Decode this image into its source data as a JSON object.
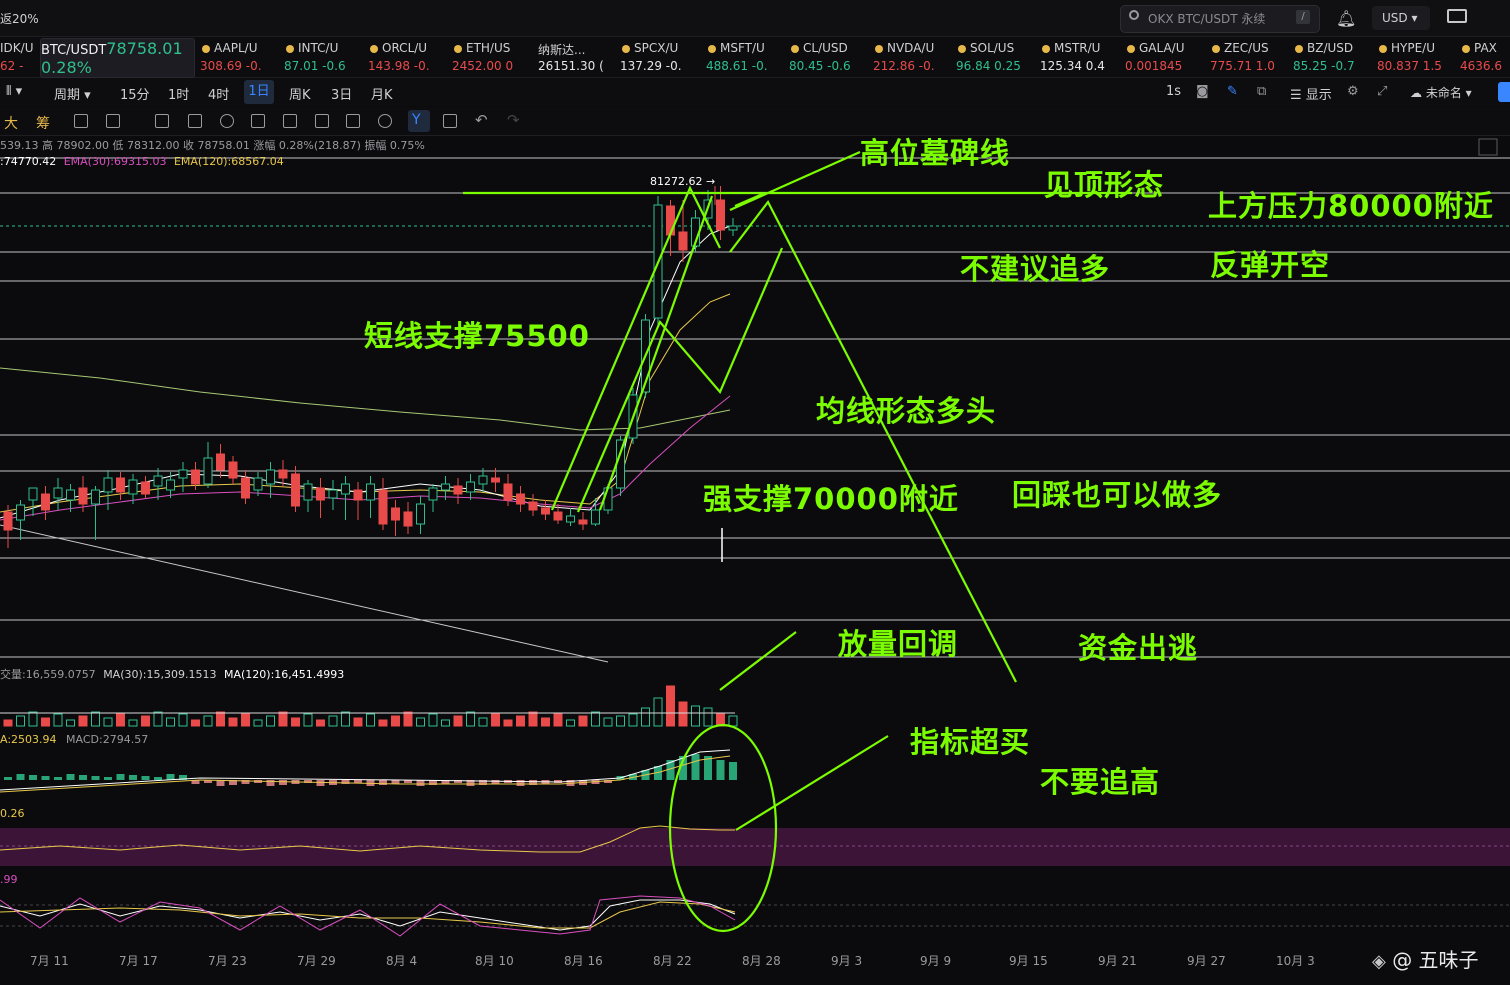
{
  "topbar": {
    "left_text": "返20%",
    "search_placeholder": "OKX BTC/USDT 永续",
    "search_key": "/",
    "currency": "USD ▾",
    "bell_icon": "bell-icon",
    "mail_icon": "mail-icon"
  },
  "tickers": [
    {
      "name": "IDK/U",
      "price": "62 -",
      "color": "red"
    },
    {
      "name": "BTC/USDT",
      "price": "78758.01  0.28%",
      "color": "grn"
    },
    {
      "name": "AAPL/U",
      "price": "308.69  -0.",
      "color": "red"
    },
    {
      "name": "INTC/U",
      "price": "87.01  -0.6",
      "color": "grn"
    },
    {
      "name": "ORCL/U",
      "price": "143.98  -0.",
      "color": "red"
    },
    {
      "name": "ETH/US",
      "price": "2452.00  0",
      "color": "red"
    },
    {
      "name": "纳斯达...",
      "price": "26151.30 (",
      "color": "wht"
    },
    {
      "name": "SPCX/U",
      "price": "137.29  -0.",
      "color": "wht"
    },
    {
      "name": "MSFT/U",
      "price": "488.61  -0.",
      "color": "grn"
    },
    {
      "name": "CL/USD",
      "price": "80.45  -0.6",
      "color": "grn"
    },
    {
      "name": "NVDA/U",
      "price": "212.86  -0.",
      "color": "red"
    },
    {
      "name": "SOL/US",
      "price": "96.84  0.25",
      "color": "grn"
    },
    {
      "name": "MSTR/U",
      "price": "125.34  0.4",
      "color": "wht"
    },
    {
      "name": "GALA/U",
      "price": "0.001845",
      "color": "red"
    },
    {
      "name": "ZEC/US",
      "price": "775.71  1.0",
      "color": "red"
    },
    {
      "name": "BZ/USD",
      "price": "85.25  -0.7",
      "color": "grn"
    },
    {
      "name": "HYPE/U",
      "price": "80.837  1.5",
      "color": "red"
    },
    {
      "name": "PAX",
      "price": "4636.6",
      "color": "red"
    }
  ],
  "toolbar": {
    "period_label": "周期",
    "intervals": [
      "15分",
      "1时",
      "4时",
      "1日",
      "周K",
      "3日",
      "月K"
    ],
    "active_interval": "1日",
    "right_items": [
      "1s",
      "显示",
      "未命名"
    ]
  },
  "drawing_tools": [
    "大",
    "筹"
  ],
  "ohlc_info": "539.13 高 78902.00 低 78312.00 收 78758.01 涨幅 0.28%(218.87) 振幅 0.75%",
  "ema_info": {
    "ema_a": ":74770.42",
    "ema30": "EMA(30):69315.03",
    "ema120": "EMA(120):68567.04"
  },
  "high_label": "81272.62 →",
  "volume_info": {
    "vol": "交量:16,559.0757",
    "ma30": "MA(30):15,309.1513",
    "ma120": "MA(120):16,451.4993"
  },
  "macd_info": {
    "a": "A:2503.94",
    "macd": "MACD:2794.57"
  },
  "rsi_info": "0.26",
  "kdj_info": ".99",
  "annotations": [
    {
      "key": "tombstone",
      "text": "高位墓碑线"
    },
    {
      "key": "top_pattern",
      "text": "见顶形态"
    },
    {
      "key": "resistance",
      "text": "上方压力80000附近"
    },
    {
      "key": "no_chase_long",
      "text": "不建议追多"
    },
    {
      "key": "rebound_short",
      "text": "反弹开空"
    },
    {
      "key": "short_support",
      "text": "短线支撑75500"
    },
    {
      "key": "ma_bullish",
      "text": "均线形态多头"
    },
    {
      "key": "strong_support",
      "text": "强支撑70000附近"
    },
    {
      "key": "pullback_long",
      "text": "回踩也可以做多"
    },
    {
      "key": "volume_pullback",
      "text": "放量回调"
    },
    {
      "key": "capital_flee",
      "text": "资金出逃"
    },
    {
      "key": "overbought",
      "text": "指标超买"
    },
    {
      "key": "no_chase_high",
      "text": "不要追高"
    }
  ],
  "x_labels": [
    "7月 11",
    "7月 17",
    "7月 23",
    "7月 29",
    "8月 4",
    "8月 10",
    "8月 16",
    "8月 22",
    "8月 28",
    "9月 3",
    "9月 9",
    "9月 15",
    "9月 21",
    "9月 27",
    "10月 3"
  ],
  "watermark": "@ 五味子",
  "colors": {
    "up": "#2fbf8a",
    "down": "#e94b4b",
    "annotation": "#7cfc00",
    "accent": "#3a86ff"
  }
}
